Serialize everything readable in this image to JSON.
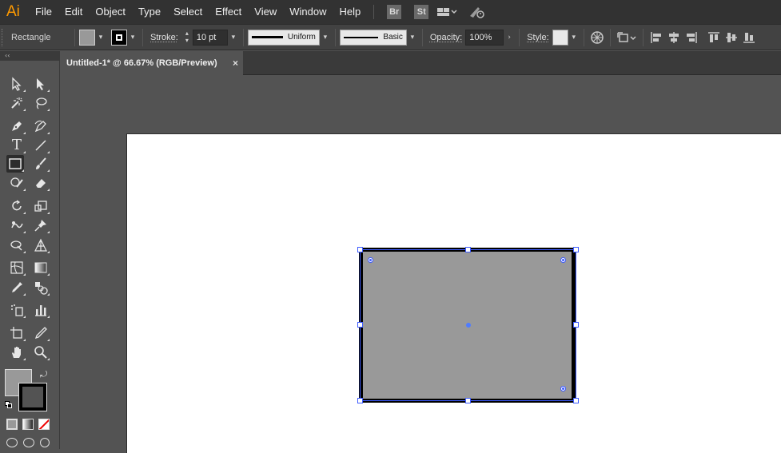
{
  "app": {
    "logo": "Ai"
  },
  "menu": [
    "File",
    "Edit",
    "Object",
    "Type",
    "Select",
    "Effect",
    "View",
    "Window",
    "Help"
  ],
  "bridge": {
    "br": "Br",
    "st": "St"
  },
  "control": {
    "tool_name": "Rectangle",
    "fill_color": "#999999",
    "stroke_label": "Stroke:",
    "stroke_value": "10 pt",
    "profile_label": "Uniform",
    "brush_label": "Basic",
    "opacity_label": "Opacity:",
    "opacity_value": "100%",
    "style_label": "Style:"
  },
  "document": {
    "tab_title": "Untitled-1* @ 66.67% (RGB/Preview)",
    "close": "×"
  },
  "tools": {
    "collapse": "‹‹",
    "type_glyph": "T"
  },
  "colors": {
    "accent": "#3d5bff",
    "logo": "#ff9a00",
    "fill": "#999999",
    "stroke": "#000000"
  }
}
